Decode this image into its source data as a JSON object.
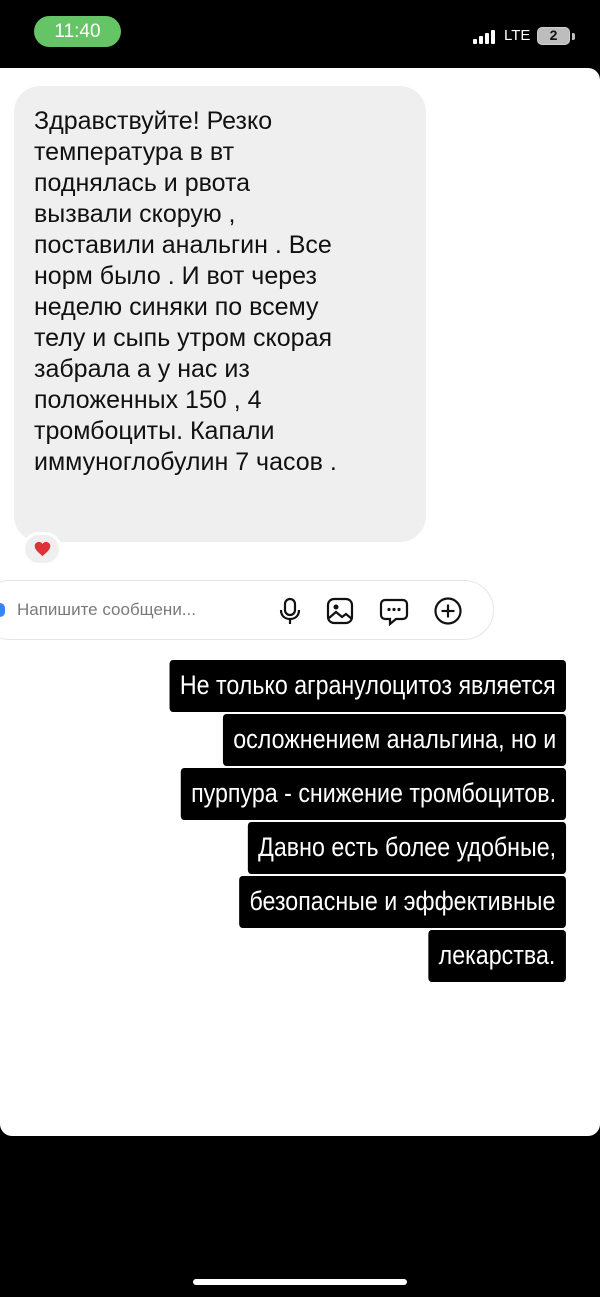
{
  "status_bar": {
    "time": "11:40",
    "network": "LTE",
    "battery_badge": "2",
    "time_pill_color": "#65c466"
  },
  "chat": {
    "message_lines": [
      "Здравствуйте! Резко",
      "температура в вт",
      "поднялась и рвота",
      "вызвали скорую ,",
      "поставили анальгин . Все",
      "норм было . И вот через",
      "неделю синяки по всему",
      "телу и сыпь утром скорая",
      "забрала а у нас из",
      "положенных 150 , 4",
      "тромбоциты. Капали",
      "иммуноглобулин 7 часов ."
    ],
    "reaction": "heart-icon",
    "bubble_color": "#efeff0"
  },
  "composer": {
    "placeholder": "Напишите сообщени...",
    "icons": [
      "microphone-icon",
      "image-icon",
      "sticker-icon",
      "add-icon"
    ]
  },
  "caption": {
    "lines": [
      "Не только агранулоцитоз является",
      "осложнением анальгина, но и",
      "пурпура - снижение тромбоцитов.",
      "Давно есть более удобные,",
      "безопасные и эффективные",
      "лекарства."
    ]
  }
}
